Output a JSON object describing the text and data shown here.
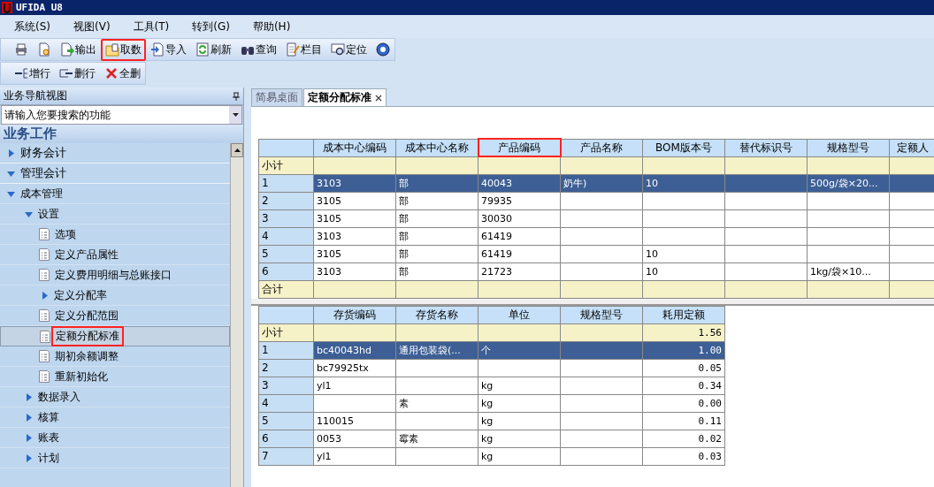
{
  "window": {
    "title": "UFIDA U8"
  },
  "menu": [
    "系统(S)",
    "视图(V)",
    "工具(T)",
    "转到(G)",
    "帮助(H)"
  ],
  "toolbar": [
    {
      "kind": "print",
      "highlighted": false
    },
    {
      "kind": "preview",
      "highlighted": false
    },
    {
      "kind": "export",
      "label": "输出",
      "highlighted": false
    },
    {
      "kind": "fetch",
      "label": "取数",
      "highlighted": true
    },
    {
      "kind": "import",
      "label": "导入",
      "highlighted": false
    },
    {
      "kind": "refresh",
      "label": "刷新",
      "highlighted": false
    },
    {
      "kind": "query",
      "label": "查询",
      "highlighted": false
    },
    {
      "kind": "columns",
      "label": "栏目",
      "highlighted": false
    },
    {
      "kind": "locate",
      "label": "定位",
      "highlighted": false
    },
    {
      "kind": "help",
      "highlighted": false
    }
  ],
  "toolbar2": [
    {
      "kind": "addrow",
      "label": "增行"
    },
    {
      "kind": "delrow",
      "label": "删行"
    },
    {
      "kind": "delall",
      "label": "全删"
    }
  ],
  "sidebar": {
    "title": "业务导航视图",
    "search_placeholder": "请输入您要搜索的功能",
    "section": "业务工作",
    "items": [
      {
        "label": "财务会计",
        "kind": "group",
        "expanded": false,
        "selected": false
      },
      {
        "label": "管理会计",
        "kind": "group",
        "expanded": true,
        "selected": false,
        "children": [
          {
            "label": "成本管理",
            "kind": "folder",
            "expanded": true,
            "selected": false,
            "children": [
              {
                "label": "设置",
                "kind": "folder",
                "expanded": true,
                "selected": false,
                "children": [
                  {
                    "label": "选项",
                    "kind": "leaf",
                    "selected": false,
                    "highlighted": false
                  },
                  {
                    "label": "定义产品属性",
                    "kind": "leaf",
                    "selected": false,
                    "highlighted": false
                  },
                  {
                    "label": "定义费用明细与总账接口",
                    "kind": "leaf",
                    "selected": false,
                    "highlighted": false
                  },
                  {
                    "label": "定义分配率",
                    "kind": "folder",
                    "expanded": false,
                    "selected": false
                  },
                  {
                    "label": "定义分配范围",
                    "kind": "leaf",
                    "selected": false,
                    "highlighted": false
                  },
                  {
                    "label": "定额分配标准",
                    "kind": "leaf",
                    "selected": true,
                    "highlighted": true
                  },
                  {
                    "label": "期初余额调整",
                    "kind": "leaf",
                    "selected": false,
                    "highlighted": false
                  },
                  {
                    "label": "重新初始化",
                    "kind": "leaf",
                    "selected": false,
                    "highlighted": false
                  }
                ]
              },
              {
                "label": "数据录入",
                "kind": "folder",
                "expanded": false,
                "selected": false
              },
              {
                "label": "核算",
                "kind": "folder",
                "expanded": false,
                "selected": false
              },
              {
                "label": "账表",
                "kind": "folder",
                "expanded": false,
                "selected": false
              },
              {
                "label": "计划",
                "kind": "folder",
                "expanded": false,
                "selected": false
              }
            ]
          }
        ]
      }
    ]
  },
  "tabs": [
    {
      "label": "简易桌面",
      "selected": false,
      "closable": false
    },
    {
      "label": "定额分配标准",
      "selected": true,
      "closable": true
    }
  ],
  "main_table": {
    "columns": [
      {
        "highlighted": false
      },
      {
        "label": "成本中心编码",
        "highlighted": false
      },
      {
        "label": "成本中心名称",
        "highlighted": false
      },
      {
        "label": "产品编码",
        "highlighted": true
      },
      {
        "label": "产品名称",
        "highlighted": false
      },
      {
        "label": "BOM版本号",
        "highlighted": false
      },
      {
        "label": "替代标识号",
        "highlighted": false
      },
      {
        "label": "规格型号",
        "highlighted": false
      },
      {
        "label": "定额人",
        "highlighted": false
      }
    ],
    "subtotal_label": "小计",
    "total_label": "合计",
    "rows": [
      {
        "selected": true,
        "cells": [
          "1",
          "3103",
          "部",
          "40043",
          "奶牛)",
          "10",
          null,
          "500g/袋×20...",
          null
        ]
      },
      {
        "selected": false,
        "cells": [
          "2",
          "3105",
          "部",
          "79935",
          null,
          null,
          null,
          null,
          null
        ]
      },
      {
        "selected": false,
        "cells": [
          "3",
          "3105",
          "部",
          "30030",
          null,
          null,
          null,
          null,
          null
        ]
      },
      {
        "selected": false,
        "cells": [
          "4",
          "3103",
          "部",
          "61419",
          null,
          null,
          null,
          null,
          null
        ]
      },
      {
        "selected": false,
        "cells": [
          "5",
          "3105",
          "部",
          "61419",
          null,
          "10",
          null,
          null,
          null
        ]
      },
      {
        "selected": false,
        "cells": [
          "6",
          "3103",
          "部",
          "21723",
          null,
          "10",
          null,
          "1kg/袋×10...",
          null
        ]
      }
    ]
  },
  "detail_table": {
    "columns": [
      "",
      "存货编码",
      "存货名称",
      "单位",
      "规格型号",
      "耗用定额"
    ],
    "subtotal_label": "小计",
    "subtotal_value": "1.56",
    "rows": [
      {
        "selected": true,
        "cells": [
          "1",
          "bc40043hd",
          "通用包装袋(...",
          "个",
          null,
          "1.00"
        ]
      },
      {
        "selected": false,
        "cells": [
          "2",
          "bc79925tx",
          null,
          null,
          null,
          "0.05"
        ]
      },
      {
        "selected": false,
        "cells": [
          "3",
          "yl1",
          null,
          "kg",
          null,
          "0.34"
        ]
      },
      {
        "selected": false,
        "cells": [
          "4",
          null,
          "素",
          "kg",
          null,
          "0.00"
        ]
      },
      {
        "selected": false,
        "cells": [
          "5",
          "110015",
          null,
          "kg",
          null,
          "0.11"
        ]
      },
      {
        "selected": false,
        "cells": [
          "6",
          "0053",
          "霉素",
          "kg",
          null,
          "0.02"
        ]
      },
      {
        "selected": false,
        "cells": [
          "7",
          "yl1",
          null,
          "kg",
          null,
          "0.03"
        ]
      }
    ]
  }
}
